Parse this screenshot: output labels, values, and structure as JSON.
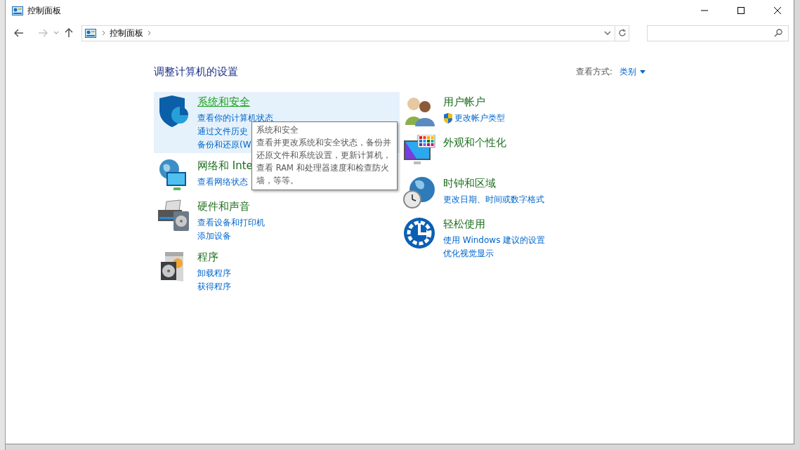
{
  "window": {
    "title": "控制面板"
  },
  "address_bar": {
    "path": [
      "控制面板"
    ]
  },
  "heading": "调整计算机的设置",
  "view_by": {
    "label": "查看方式:",
    "value": "类别"
  },
  "columns": [
    {
      "categories": [
        {
          "title": "系统和安全",
          "hovered": true,
          "links": [
            {
              "text": "查看你的计算机状态",
              "kind": "plain"
            },
            {
              "text": "通过文件历史",
              "kind": "plain"
            },
            {
              "text": "备份和还原(W",
              "kind": "plain"
            }
          ]
        },
        {
          "title": "网络和 Inte",
          "hovered": false,
          "links": [
            {
              "text": "查看网络状态",
              "kind": "plain"
            }
          ]
        },
        {
          "title": "硬件和声音",
          "hovered": false,
          "links": [
            {
              "text": "查看设备和打印机",
              "kind": "plain"
            },
            {
              "text": "添加设备",
              "kind": "plain"
            }
          ]
        },
        {
          "title": "程序",
          "hovered": false,
          "links": [
            {
              "text": "卸载程序",
              "kind": "plain"
            },
            {
              "text": "获得程序",
              "kind": "plain"
            }
          ]
        }
      ]
    },
    {
      "categories": [
        {
          "title": "用户帐户",
          "hovered": false,
          "links": [
            {
              "text": "更改帐户类型",
              "kind": "admin"
            }
          ]
        },
        {
          "title": "外观和个性化",
          "hovered": false
        },
        {
          "title": "时钟和区域",
          "hovered": false,
          "links": [
            {
              "text": "更改日期、时间或数字格式",
              "kind": "plain"
            }
          ]
        },
        {
          "title": "轻松使用",
          "hovered": false,
          "links": [
            {
              "text": "使用 Windows 建议的设置",
              "kind": "plain"
            },
            {
              "text": "优化视觉显示",
              "kind": "plain"
            }
          ]
        }
      ]
    }
  ],
  "tooltip": {
    "title": "系统和安全",
    "text": "查看并更改系统和安全状态，备份并还原文件和系统设置，更新计算机，查看 RAM 和处理器速度和检查防火墙，等等。"
  }
}
